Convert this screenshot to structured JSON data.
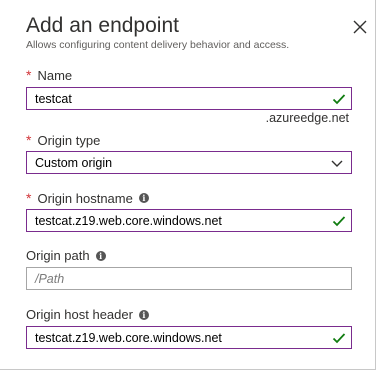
{
  "header": {
    "title": "Add an endpoint",
    "subtitle": "Allows configuring content delivery behavior and access."
  },
  "fields": {
    "name": {
      "label": "Name",
      "value": "testcat",
      "suffix": ".azureedge.net",
      "required": true
    },
    "origin_type": {
      "label": "Origin type",
      "value": "Custom origin",
      "required": true
    },
    "origin_hostname": {
      "label": "Origin hostname",
      "value": "testcat.z19.web.core.windows.net",
      "required": true
    },
    "origin_path": {
      "label": "Origin path",
      "value": "",
      "placeholder": "/Path",
      "required": false
    },
    "origin_host_header": {
      "label": "Origin host header",
      "value": "testcat.z19.web.core.windows.net",
      "required": false
    }
  },
  "icons": {
    "close": "close-icon",
    "valid": "checkmark-icon",
    "dropdown": "chevron-down-icon",
    "info": "info-icon"
  },
  "colors": {
    "required_asterisk": "#d13438",
    "valid_border": "#7a2c8e",
    "valid_check": "#107c10"
  }
}
